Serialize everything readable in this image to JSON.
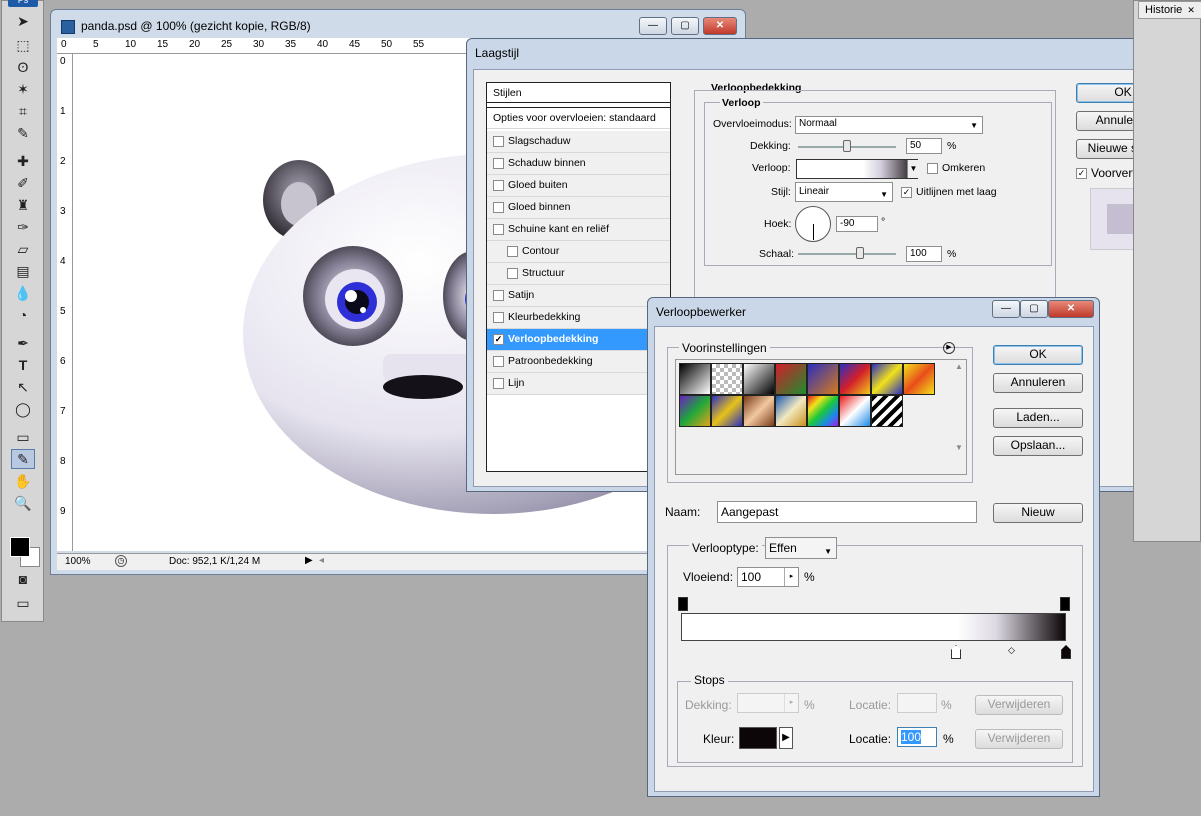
{
  "app": {
    "logo": "Ps"
  },
  "document": {
    "title": "panda.psd @ 100% (gezicht kopie, RGB/8)",
    "ruler_top": [
      "0",
      "5",
      "10",
      "15",
      "20",
      "25",
      "30",
      "35",
      "40",
      "45",
      "50",
      "55"
    ],
    "ruler_left": [
      "0",
      "1",
      "2",
      "3",
      "4",
      "5",
      "6",
      "7",
      "8",
      "9"
    ],
    "zoom": "100%",
    "doc_info": "Doc: 952,1 K/1,24 M"
  },
  "layer_style": {
    "title": "Laagstijl",
    "styles_header": "Stijlen",
    "blend_options": "Opties voor overvloeien: standaard",
    "items": [
      {
        "label": "Slagschaduw",
        "checked": false,
        "indent": false
      },
      {
        "label": "Schaduw binnen",
        "checked": false,
        "indent": false
      },
      {
        "label": "Gloed buiten",
        "checked": false,
        "indent": false
      },
      {
        "label": "Gloed binnen",
        "checked": false,
        "indent": false
      },
      {
        "label": "Schuine kant en reliëf",
        "checked": false,
        "indent": false
      },
      {
        "label": "Contour",
        "checked": false,
        "indent": true
      },
      {
        "label": "Structuur",
        "checked": false,
        "indent": true
      },
      {
        "label": "Satijn",
        "checked": false,
        "indent": false
      },
      {
        "label": "Kleurbedekking",
        "checked": false,
        "indent": false
      },
      {
        "label": "Verloopbedekking",
        "checked": true,
        "indent": false,
        "selected": true
      },
      {
        "label": "Patroonbedekking",
        "checked": false,
        "indent": false
      },
      {
        "label": "Lijn",
        "checked": false,
        "indent": false
      }
    ],
    "section_title": "Verloopbedekking",
    "group_title": "Verloop",
    "blend_mode_label": "Overvloeimodus:",
    "blend_mode_value": "Normaal",
    "opacity_label": "Dekking:",
    "opacity_value": "50",
    "percent": "%",
    "gradient_label": "Verloop:",
    "reverse_label": "Omkeren",
    "style_label": "Stijl:",
    "style_value": "Lineair",
    "align_label": "Uitlijnen met laag",
    "angle_label": "Hoek:",
    "angle_value": "-90",
    "degree": "°",
    "scale_label": "Schaal:",
    "scale_value": "100",
    "ok": "OK",
    "cancel": "Annuleren",
    "new_style": "Nieuwe stijl...",
    "preview": "Voorvertoning"
  },
  "gradient_editor": {
    "title": "Verloopbewerker",
    "presets_label": "Voorinstellingen",
    "ok": "OK",
    "cancel": "Annuleren",
    "load": "Laden...",
    "save": "Opslaan...",
    "name_label": "Naam:",
    "name_value": "Aangepast",
    "new": "Nieuw",
    "type_label": "Verlooptype:",
    "type_value": "Effen",
    "smooth_label": "Vloeiend:",
    "smooth_value": "100",
    "percent": "%",
    "stops_label": "Stops",
    "opacity_label": "Dekking:",
    "location_label": "Locatie:",
    "delete": "Verwijderen",
    "color_label": "Kleur:",
    "color_location_value": "100",
    "stop_color": "#0d0608"
  },
  "history": {
    "tab": "Historie"
  }
}
